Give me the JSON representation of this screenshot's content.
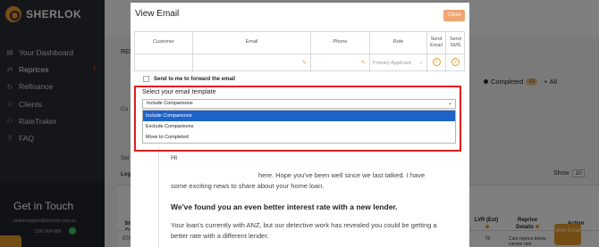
{
  "app": {
    "name": "SHERLOK"
  },
  "sidebar": {
    "items": [
      {
        "label": "Your Dashboard",
        "icon": "dashboard-icon",
        "glyph": "▤"
      },
      {
        "label": "Reprices",
        "icon": "reprice-icon",
        "glyph": "⇄",
        "alert": "!"
      },
      {
        "label": "Refinance",
        "icon": "refinance-icon",
        "glyph": "↻"
      },
      {
        "label": "Clients",
        "icon": "clients-icon",
        "glyph": "☺"
      },
      {
        "label": "RateTraker",
        "icon": "ratetracker-icon",
        "glyph": "⚇"
      },
      {
        "label": "FAQ",
        "icon": "faq-icon",
        "glyph": "?"
      }
    ],
    "contact": {
      "title": "Get in Touch",
      "email": "brokersupport@sherlok.com.au",
      "phone": "1300 864 885"
    }
  },
  "background": {
    "ref_label": "REF",
    "tabs": [
      {
        "label": "Completed",
        "count": "10"
      },
      {
        "label": "All"
      }
    ],
    "left_labels": [
      "Cu",
      "Sel",
      "Lega"
    ],
    "show_label": "Show",
    "show_value": "10",
    "table_headers": [
      "Sta Da",
      "LVR (Est)",
      "Reprice Details",
      "Action"
    ],
    "row": {
      "date": "07/0",
      "lvr": "%",
      "reprice": "Cant reprice below current rate",
      "action": "View Email"
    }
  },
  "modal": {
    "title": "View Email",
    "close_label": "Close",
    "columns": [
      "Customer",
      "Email",
      "Phone",
      "Role",
      "Send Email",
      "Send SMS"
    ],
    "row": {
      "role_value": "Primary Applicant"
    },
    "forward_label": "Send to me to forward the email",
    "template_label": "Select your email template",
    "template_selected": "Include Comparisons",
    "template_options": [
      "Include Comparisons",
      "Exclude Comparisons",
      "Move to Completed"
    ],
    "preview": {
      "greeting": "Hi",
      "paragraph1": "here. Hope you've been well since we last talked. I have some exciting news to share about your home loan.",
      "heading": "We've found you an even better interest rate with a new lender.",
      "paragraph2": "Your loan's currently with ANZ, but our detective work has revealed you could be getting a better rate with a different lender."
    }
  }
}
